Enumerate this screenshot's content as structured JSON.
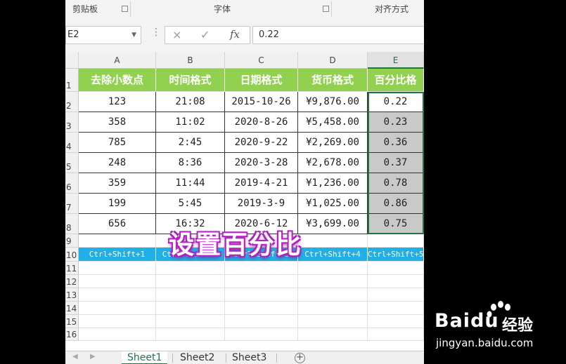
{
  "ribbon": {
    "groups": [
      "剪贴板",
      "字体",
      "对齐方式"
    ]
  },
  "formula_bar": {
    "name_box": "E2",
    "cancel_icon": "×",
    "enter_icon": "✓",
    "fx_label": "fx",
    "formula_value": "0.22"
  },
  "grid": {
    "columns": [
      "A",
      "B",
      "C",
      "D",
      "E"
    ],
    "rows": [
      "1",
      "2",
      "3",
      "4",
      "5",
      "6",
      "7",
      "8",
      "9",
      "10",
      "11",
      "12",
      "13",
      "14",
      "15",
      "16"
    ],
    "headers": [
      "去除小数点",
      "时间格式",
      "日期格式",
      "货币格式",
      "百分比格"
    ],
    "data": [
      [
        "123",
        "21:08",
        "2015-10-26",
        "¥9,876.00",
        "0.22"
      ],
      [
        "358",
        "11:02",
        "2020-8-26",
        "¥5,458.00",
        "0.23"
      ],
      [
        "785",
        "2:45",
        "2020-9-22",
        "¥2,269.00",
        "0.36"
      ],
      [
        "248",
        "8:36",
        "2020-3-28",
        "¥2,678.00",
        "0.37"
      ],
      [
        "359",
        "11:44",
        "2019-4-21",
        "¥1,236.00",
        "0.78"
      ],
      [
        "199",
        "5:45",
        "2019-3-9",
        "¥1,025.00",
        "0.86"
      ],
      [
        "656",
        "16:32",
        "2020-6-12",
        "¥3,699.00",
        "0.75"
      ]
    ],
    "shortcuts": [
      "Ctrl+Shift+1",
      "Ctrl+Shift+2",
      "Ctrl+Shift+3",
      "Ctrl+Shift+4",
      "Ctrl+Shift+5"
    ]
  },
  "caption": "设置百分比",
  "sheets": [
    "Sheet1",
    "Sheet2",
    "Sheet3"
  ],
  "add_sheet_icon": "+",
  "watermark": {
    "logo": "Bai",
    "logo_suffix": "du",
    "cn": "经验",
    "url": "jingyan.baidu.com"
  },
  "colors": {
    "header_green": "#92d050",
    "shortcut_blue": "#1fb0e8",
    "selection_green": "#217346",
    "selected_fill": "#c9c9c9"
  }
}
